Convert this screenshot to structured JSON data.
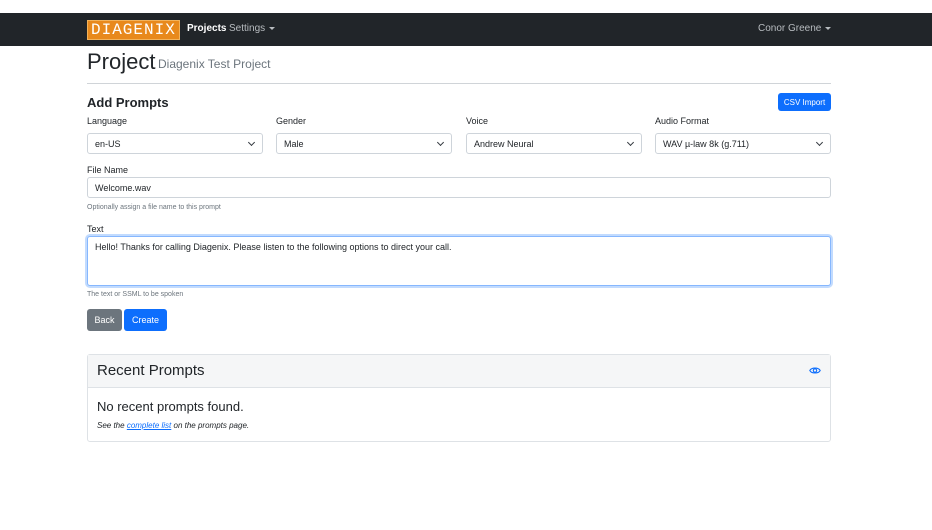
{
  "nav": {
    "brand": "DIAGENIX",
    "projects": "Projects",
    "settings": "Settings",
    "user": "Conor Greene"
  },
  "header": {
    "title": "Project",
    "subtitle": "Diagenix Test Project"
  },
  "form": {
    "heading": "Add Prompts",
    "csv_import_label": "CSV Import",
    "language": {
      "label": "Language",
      "value": "en-US"
    },
    "gender": {
      "label": "Gender",
      "value": "Male"
    },
    "voice": {
      "label": "Voice",
      "value": "Andrew Neural"
    },
    "audio_format": {
      "label": "Audio Format",
      "value": "WAV µ-law 8k (g.711)"
    },
    "file_name": {
      "label": "File Name",
      "value": "Welcome.wav",
      "help": "Optionally assign a file name to this prompt"
    },
    "text": {
      "label": "Text",
      "value": "Hello! Thanks for calling Diagenix. Please listen to the following options to direct your call.",
      "help": "The text or SSML to be spoken"
    },
    "back_label": "Back",
    "create_label": "Create"
  },
  "recent": {
    "title": "Recent Prompts",
    "empty_title": "No recent prompts found.",
    "note_prefix": "See the ",
    "note_link": "complete list",
    "note_suffix": " on the prompts page."
  },
  "icons": {
    "eye": "eye-icon",
    "chevron": "chevron-down-icon",
    "caret": "caret-down-icon"
  },
  "colors": {
    "navbar": "#212529",
    "brand": "#e8891c",
    "primary": "#0d6efd",
    "secondary": "#6c757d"
  }
}
